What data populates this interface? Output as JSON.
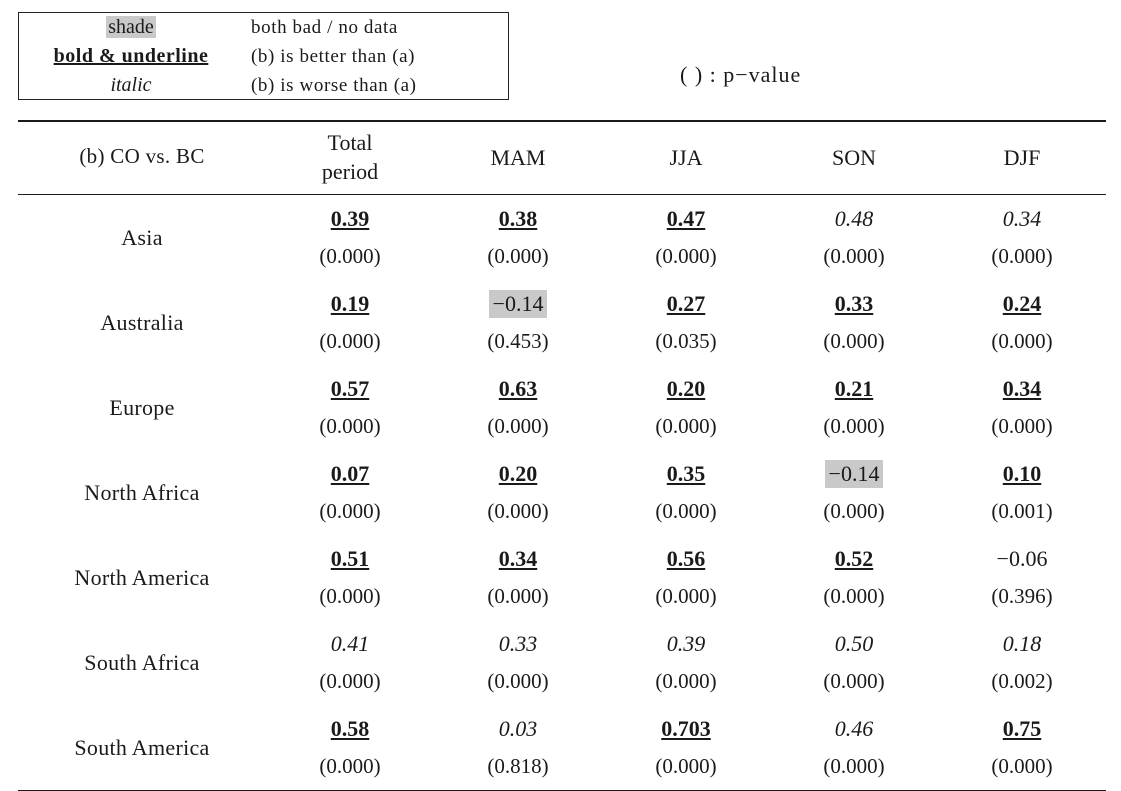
{
  "legend": {
    "rows": [
      {
        "key": "shade",
        "style": "shade",
        "desc": "both bad / no data"
      },
      {
        "key": "bold & underline",
        "style": "bold-underline",
        "desc": "(b) is better than (a)"
      },
      {
        "key": "italic",
        "style": "italic",
        "desc": "(b) is worse than (a)"
      }
    ]
  },
  "pvalue_note": "(  ) : p−value",
  "table": {
    "corner_label": "(b)  CO vs. BC",
    "columns": [
      {
        "id": "total",
        "label_line1": "Total",
        "label_line2": "period"
      },
      {
        "id": "mam",
        "label_line1": "MAM",
        "label_line2": ""
      },
      {
        "id": "jja",
        "label_line1": "JJA",
        "label_line2": ""
      },
      {
        "id": "son",
        "label_line1": "SON",
        "label_line2": ""
      },
      {
        "id": "djf",
        "label_line1": "DJF",
        "label_line2": ""
      }
    ],
    "rows": [
      {
        "region": "Asia",
        "cells": [
          {
            "value": "0.39",
            "style": "better",
            "shaded": false,
            "p": "(0.000)"
          },
          {
            "value": "0.38",
            "style": "better",
            "shaded": false,
            "p": "(0.000)"
          },
          {
            "value": "0.47",
            "style": "better",
            "shaded": false,
            "p": "(0.000)"
          },
          {
            "value": "0.48",
            "style": "worse",
            "shaded": false,
            "p": "(0.000)"
          },
          {
            "value": "0.34",
            "style": "worse",
            "shaded": false,
            "p": "(0.000)"
          }
        ]
      },
      {
        "region": "Australia",
        "cells": [
          {
            "value": "0.19",
            "style": "better",
            "shaded": false,
            "p": "(0.000)"
          },
          {
            "value": "−0.14",
            "style": "plain",
            "shaded": true,
            "p": "(0.453)"
          },
          {
            "value": "0.27",
            "style": "better",
            "shaded": false,
            "p": "(0.035)"
          },
          {
            "value": "0.33",
            "style": "better",
            "shaded": false,
            "p": "(0.000)"
          },
          {
            "value": "0.24",
            "style": "better",
            "shaded": false,
            "p": "(0.000)"
          }
        ]
      },
      {
        "region": "Europe",
        "cells": [
          {
            "value": "0.57",
            "style": "better",
            "shaded": false,
            "p": "(0.000)"
          },
          {
            "value": "0.63",
            "style": "better",
            "shaded": false,
            "p": "(0.000)"
          },
          {
            "value": "0.20",
            "style": "better",
            "shaded": false,
            "p": "(0.000)"
          },
          {
            "value": "0.21",
            "style": "better",
            "shaded": false,
            "p": "(0.000)"
          },
          {
            "value": "0.34",
            "style": "better",
            "shaded": false,
            "p": "(0.000)"
          }
        ]
      },
      {
        "region": "North Africa",
        "cells": [
          {
            "value": "0.07",
            "style": "better",
            "shaded": false,
            "p": "(0.000)"
          },
          {
            "value": "0.20",
            "style": "better",
            "shaded": false,
            "p": "(0.000)"
          },
          {
            "value": "0.35",
            "style": "better",
            "shaded": false,
            "p": "(0.000)"
          },
          {
            "value": "−0.14",
            "style": "plain",
            "shaded": true,
            "p": "(0.000)"
          },
          {
            "value": "0.10",
            "style": "better",
            "shaded": false,
            "p": "(0.001)"
          }
        ]
      },
      {
        "region": "North America",
        "cells": [
          {
            "value": "0.51",
            "style": "better",
            "shaded": false,
            "p": "(0.000)"
          },
          {
            "value": "0.34",
            "style": "better",
            "shaded": false,
            "p": "(0.000)"
          },
          {
            "value": "0.56",
            "style": "better",
            "shaded": false,
            "p": "(0.000)"
          },
          {
            "value": "0.52",
            "style": "better",
            "shaded": false,
            "p": "(0.000)"
          },
          {
            "value": "−0.06",
            "style": "plain",
            "shaded": false,
            "p": "(0.396)"
          }
        ]
      },
      {
        "region": "South Africa",
        "cells": [
          {
            "value": "0.41",
            "style": "worse",
            "shaded": false,
            "p": "(0.000)"
          },
          {
            "value": "0.33",
            "style": "worse",
            "shaded": false,
            "p": "(0.000)"
          },
          {
            "value": "0.39",
            "style": "worse",
            "shaded": false,
            "p": "(0.000)"
          },
          {
            "value": "0.50",
            "style": "worse",
            "shaded": false,
            "p": "(0.000)"
          },
          {
            "value": "0.18",
            "style": "worse",
            "shaded": false,
            "p": "(0.002)"
          }
        ]
      },
      {
        "region": "South America",
        "cells": [
          {
            "value": "0.58",
            "style": "better",
            "shaded": false,
            "p": "(0.000)"
          },
          {
            "value": "0.03",
            "style": "worse",
            "shaded": false,
            "p": "(0.818)"
          },
          {
            "value": "0.703",
            "style": "better",
            "shaded": false,
            "p": "(0.000)"
          },
          {
            "value": "0.46",
            "style": "worse",
            "shaded": false,
            "p": "(0.000)"
          },
          {
            "value": "0.75",
            "style": "better",
            "shaded": false,
            "p": "(0.000)"
          }
        ]
      }
    ]
  },
  "colors": {
    "shade": "#c9c9c9",
    "rule": "#1a1a1a",
    "text": "#1a1a1a"
  }
}
